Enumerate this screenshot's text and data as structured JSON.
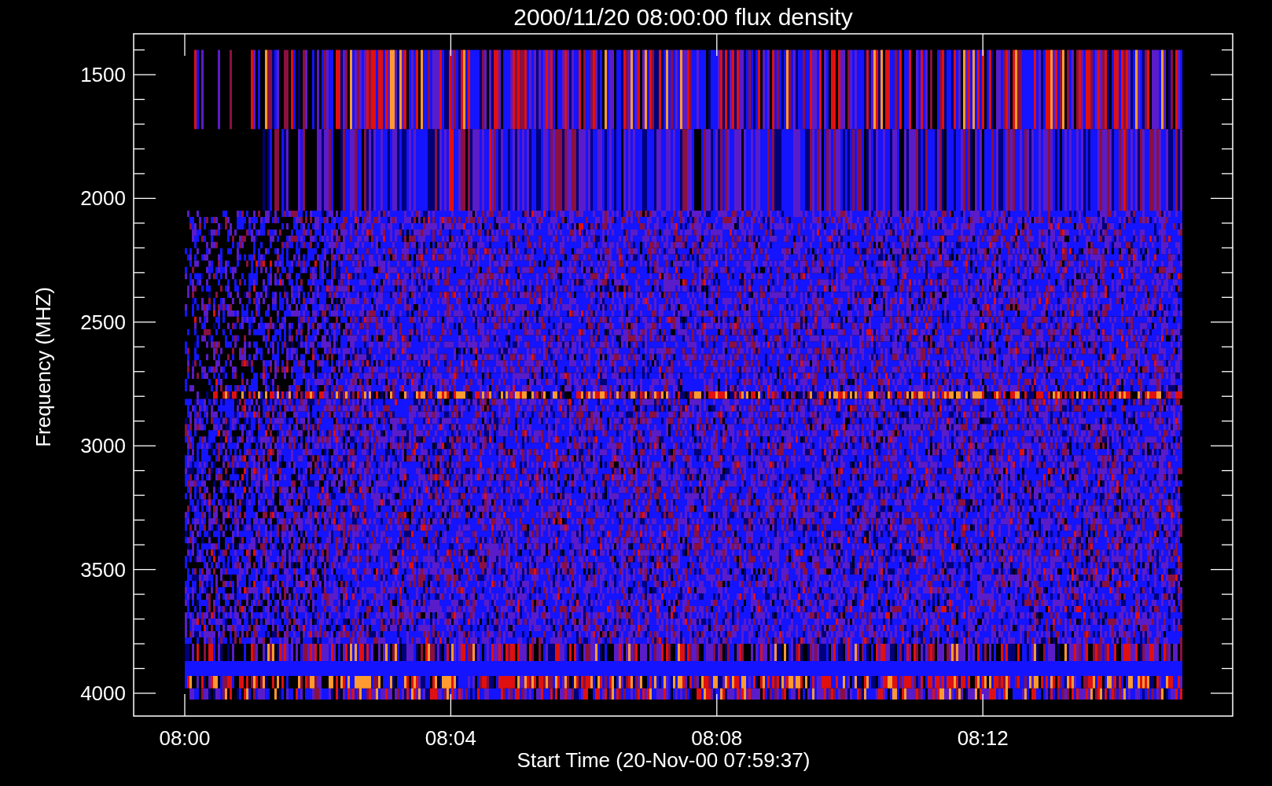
{
  "title": "2000/11/20 08:00:00 flux density",
  "ylabel": "Frequency (MHZ)",
  "xlabel": "Start Time (20-Nov-00 07:59:37)",
  "yticks": [
    "1500",
    "2000",
    "2500",
    "3000",
    "3500",
    "4000"
  ],
  "xticks": [
    "08:00",
    "08:04",
    "08:08",
    "08:12"
  ]
}
